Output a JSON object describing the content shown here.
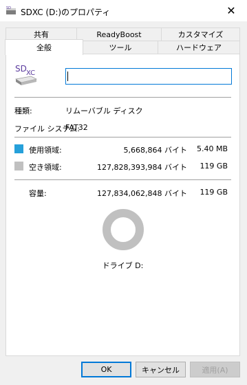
{
  "window": {
    "title": "SDXC (D:)のプロパティ"
  },
  "tabs": {
    "row1": [
      "共有",
      "ReadyBoost",
      "カスタマイズ"
    ],
    "row2": [
      "全般",
      "ツール",
      "ハードウェア"
    ],
    "active": "全般"
  },
  "drive": {
    "icon_label": "SDXC",
    "name_value": "",
    "type_label": "種類:",
    "type_value": "リムーバブル ディスク",
    "fs_label": "ファイル システム:",
    "fs_value": "FAT32"
  },
  "usage": {
    "used": {
      "label": "使用領域:",
      "bytes": "5,668,864 バイト",
      "size": "5.40 MB",
      "color": "#26a0da"
    },
    "free": {
      "label": "空き領域:",
      "bytes": "127,828,393,984 バイト",
      "size": "119 GB",
      "color": "#c0c0c0"
    },
    "capacity": {
      "label": "容量:",
      "bytes": "127,834,062,848 バイト",
      "size": "119 GB"
    },
    "used_fraction": 4.43e-05,
    "drive_label": "ドライブ D:"
  },
  "buttons": {
    "ok": "OK",
    "cancel": "キャンセル",
    "apply": "適用(A)"
  },
  "close_glyph": "✕"
}
